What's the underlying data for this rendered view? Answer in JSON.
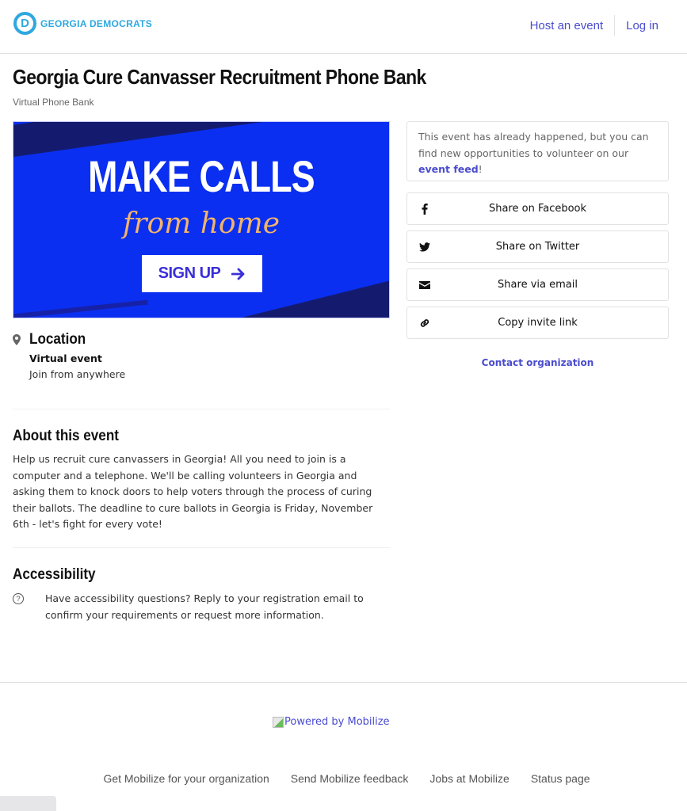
{
  "header": {
    "logo_text": "GEORGIA DEMOCRATS",
    "logo_letter": "D",
    "nav": [
      {
        "label": "Host an event"
      },
      {
        "label": "Log in"
      }
    ]
  },
  "event": {
    "title": "Georgia Cure Canvasser Recruitment Phone Bank",
    "type": "Virtual Phone Bank",
    "banner": {
      "headline": "MAKE CALLS",
      "script": "from home",
      "cta_label": "SIGN UP",
      "cta_icon": "arrow-right-icon"
    },
    "location": {
      "heading": "Location",
      "name": "Virtual event",
      "detail": "Join from anywhere",
      "icon": "map-pin-icon"
    },
    "about": {
      "heading": "About this event",
      "text": "Help us recruit cure canvassers in Georgia! All you need to join is a computer and a telephone. We'll be calling volunteers in Georgia and asking them to knock doors to help voters through the process of curing their ballots. The deadline to cure ballots in Georgia is Friday, November 6th - let's fight for every vote!"
    },
    "accessibility": {
      "heading": "Accessibility",
      "icon": "question-circle-icon",
      "text": "Have accessibility questions? Reply to your registration email to confirm your requirements or request more information."
    }
  },
  "sidebar": {
    "notice": {
      "text_before": "This event has already happened, but you can find new opportunities to volunteer on our ",
      "link_label": "event feed",
      "text_after": "!"
    },
    "share_buttons": [
      {
        "label": "Share on Facebook",
        "icon": "facebook-icon"
      },
      {
        "label": "Share on Twitter",
        "icon": "twitter-icon"
      },
      {
        "label": "Share via email",
        "icon": "envelope-icon"
      },
      {
        "label": "Copy invite link",
        "icon": "link-icon"
      }
    ],
    "contact_label": "Contact organization"
  },
  "footer": {
    "powered_by": "Powered by Mobilize",
    "links": [
      {
        "label": "Get Mobilize for your organization"
      },
      {
        "label": "Send Mobilize feedback"
      },
      {
        "label": "Jobs at Mobilize"
      },
      {
        "label": "Status page"
      }
    ]
  },
  "colors": {
    "brand": "#2ea8df",
    "link": "#4a4ccf",
    "banner_blue": "#0a2ff0",
    "banner_accent": "#f2b46a"
  }
}
